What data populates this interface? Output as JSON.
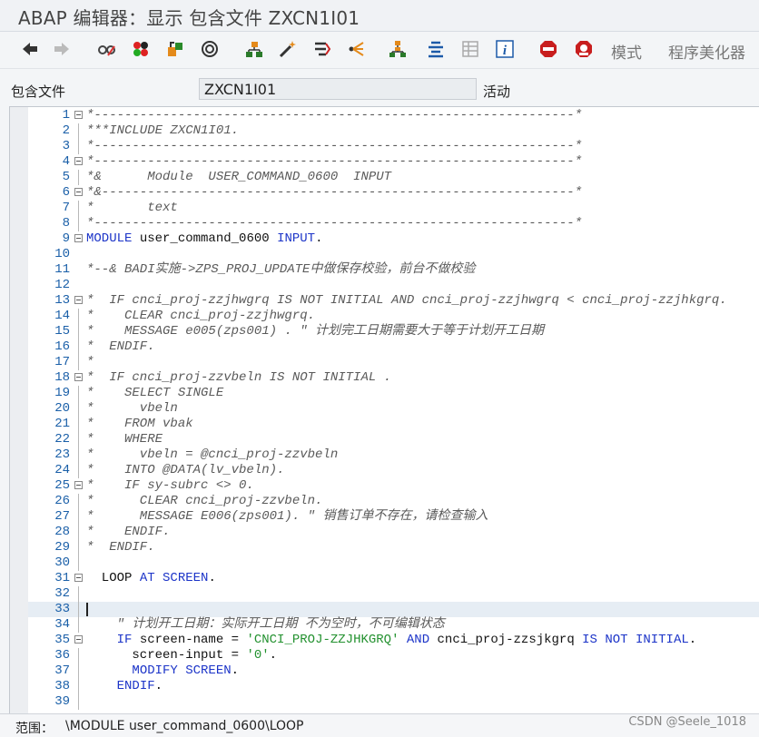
{
  "window": {
    "title": "ABAP 编辑器：显示 包含文件 ZXCN1I01"
  },
  "toolbar": {
    "icons": [
      "back-arrow-icon",
      "forward-arrow-icon",
      "glasses-display-change-icon",
      "activate-icon",
      "object-transfer-icon",
      "object-list-icon",
      "hierarchy-icon",
      "magic-wand-icon",
      "where-used-icon",
      "navigate-icon",
      "org-chart-icon",
      "pretty-list-icon",
      "table-grid-icon",
      "info-icon",
      "stop-breakpoint-icon",
      "session-breakpoint-icon"
    ],
    "mode_label": "模式",
    "pretty_printer_label": "程序美化器"
  },
  "header": {
    "include_label": "包含文件",
    "include_value": "ZXCN1I01",
    "status": "活动"
  },
  "editor": {
    "lines": [
      {
        "n": "1",
        "fold": "start",
        "segs": [
          {
            "t": "c",
            "v": "*---------------------------------------------------------------*"
          }
        ]
      },
      {
        "n": "2",
        "fold": "line",
        "segs": [
          {
            "t": "c",
            "v": "***INCLUDE ZXCN1I01."
          }
        ]
      },
      {
        "n": "3",
        "fold": "line",
        "segs": [
          {
            "t": "c",
            "v": "*---------------------------------------------------------------*"
          }
        ]
      },
      {
        "n": "4",
        "fold": "start",
        "segs": [
          {
            "t": "c",
            "v": "*---------------------------------------------------------------*"
          }
        ]
      },
      {
        "n": "5",
        "fold": "line",
        "segs": [
          {
            "t": "c",
            "v": "*&      Module  USER_COMMAND_0600  INPUT"
          }
        ]
      },
      {
        "n": "6",
        "fold": "start",
        "segs": [
          {
            "t": "c",
            "v": "*&--------------------------------------------------------------*"
          }
        ]
      },
      {
        "n": "7",
        "fold": "line",
        "segs": [
          {
            "t": "c",
            "v": "*       text"
          }
        ]
      },
      {
        "n": "8",
        "fold": "line",
        "segs": [
          {
            "t": "c",
            "v": "*---------------------------------------------------------------*"
          }
        ]
      },
      {
        "n": "9",
        "fold": "start",
        "segs": [
          {
            "t": "k",
            "v": "MODULE"
          },
          {
            "t": "n",
            "v": " user_command_0600 "
          },
          {
            "t": "k",
            "v": "INPUT"
          },
          {
            "t": "n",
            "v": "."
          }
        ]
      },
      {
        "n": "10",
        "fold": "none",
        "segs": []
      },
      {
        "n": "11",
        "fold": "none",
        "segs": [
          {
            "t": "c",
            "v": "*--& BADI实施->ZPS_PROJ_UPDATE中做保存校验，前台不做校验"
          }
        ]
      },
      {
        "n": "12",
        "fold": "none",
        "segs": []
      },
      {
        "n": "13",
        "fold": "start",
        "segs": [
          {
            "t": "c",
            "v": "*  IF cnci_proj-zzjhwgrq IS NOT INITIAL AND cnci_proj-zzjhwgrq < cnci_proj-zzjhkgrq."
          }
        ]
      },
      {
        "n": "14",
        "fold": "line",
        "segs": [
          {
            "t": "c",
            "v": "*    CLEAR cnci_proj-zzjhwgrq."
          }
        ]
      },
      {
        "n": "15",
        "fold": "line",
        "segs": [
          {
            "t": "c",
            "v": "*    MESSAGE e005(zps001) . \" 计划完工日期需要大于等于计划开工日期"
          }
        ]
      },
      {
        "n": "16",
        "fold": "line",
        "segs": [
          {
            "t": "c",
            "v": "*  ENDIF."
          }
        ]
      },
      {
        "n": "17",
        "fold": "line",
        "segs": [
          {
            "t": "c",
            "v": "*"
          }
        ]
      },
      {
        "n": "18",
        "fold": "start",
        "segs": [
          {
            "t": "c",
            "v": "*  IF cnci_proj-zzvbeln IS NOT INITIAL ."
          }
        ]
      },
      {
        "n": "19",
        "fold": "line",
        "segs": [
          {
            "t": "c",
            "v": "*    SELECT SINGLE"
          }
        ]
      },
      {
        "n": "20",
        "fold": "line",
        "segs": [
          {
            "t": "c",
            "v": "*      vbeln"
          }
        ]
      },
      {
        "n": "21",
        "fold": "line",
        "segs": [
          {
            "t": "c",
            "v": "*    FROM vbak"
          }
        ]
      },
      {
        "n": "22",
        "fold": "line",
        "segs": [
          {
            "t": "c",
            "v": "*    WHERE"
          }
        ]
      },
      {
        "n": "23",
        "fold": "line",
        "segs": [
          {
            "t": "c",
            "v": "*      vbeln = @cnci_proj-zzvbeln"
          }
        ]
      },
      {
        "n": "24",
        "fold": "line",
        "segs": [
          {
            "t": "c",
            "v": "*    INTO @DATA(lv_vbeln)."
          }
        ]
      },
      {
        "n": "25",
        "fold": "start",
        "segs": [
          {
            "t": "c",
            "v": "*    IF sy-subrc <> 0."
          }
        ]
      },
      {
        "n": "26",
        "fold": "line",
        "segs": [
          {
            "t": "c",
            "v": "*      CLEAR cnci_proj-zzvbeln."
          }
        ]
      },
      {
        "n": "27",
        "fold": "line",
        "segs": [
          {
            "t": "c",
            "v": "*      MESSAGE E006(zps001). \" 销售订单不存在，请检查输入"
          }
        ]
      },
      {
        "n": "28",
        "fold": "line",
        "segs": [
          {
            "t": "c",
            "v": "*    ENDIF."
          }
        ]
      },
      {
        "n": "29",
        "fold": "line",
        "segs": [
          {
            "t": "c",
            "v": "*  ENDIF."
          }
        ]
      },
      {
        "n": "30",
        "fold": "line",
        "segs": []
      },
      {
        "n": "31",
        "fold": "start",
        "segs": [
          {
            "t": "n",
            "v": "  LOOP "
          },
          {
            "t": "k",
            "v": "AT SCREEN"
          },
          {
            "t": "n",
            "v": "."
          }
        ]
      },
      {
        "n": "32",
        "fold": "line",
        "segs": []
      },
      {
        "n": "33",
        "fold": "line",
        "cur": true,
        "segs": []
      },
      {
        "n": "34",
        "fold": "line",
        "segs": [
          {
            "t": "c",
            "v": "    \" 计划开工日期：实际开工日期 不为空时，不可编辑状态"
          }
        ]
      },
      {
        "n": "35",
        "fold": "start",
        "segs": [
          {
            "t": "n",
            "v": "    "
          },
          {
            "t": "k",
            "v": "IF"
          },
          {
            "t": "n",
            "v": " screen-name = "
          },
          {
            "t": "s",
            "v": "'CNCI_PROJ-ZZJHKGRQ'"
          },
          {
            "t": "n",
            "v": " "
          },
          {
            "t": "k",
            "v": "AND"
          },
          {
            "t": "n",
            "v": " cnci_proj-zzsjkgrq "
          },
          {
            "t": "k",
            "v": "IS NOT INITIAL"
          },
          {
            "t": "n",
            "v": "."
          }
        ]
      },
      {
        "n": "36",
        "fold": "line",
        "segs": [
          {
            "t": "n",
            "v": "      screen-input = "
          },
          {
            "t": "s",
            "v": "'0'"
          },
          {
            "t": "n",
            "v": "."
          }
        ]
      },
      {
        "n": "37",
        "fold": "line",
        "segs": [
          {
            "t": "n",
            "v": "      "
          },
          {
            "t": "k",
            "v": "MODIFY SCREEN"
          },
          {
            "t": "n",
            "v": "."
          }
        ]
      },
      {
        "n": "38",
        "fold": "line",
        "segs": [
          {
            "t": "n",
            "v": "    "
          },
          {
            "t": "k",
            "v": "ENDIF"
          },
          {
            "t": "n",
            "v": "."
          }
        ]
      },
      {
        "n": "39",
        "fold": "line",
        "segs": []
      }
    ]
  },
  "statusbar": {
    "scope_label": "范围：",
    "scope_value": "\\MODULE user_command_0600\\LOOP"
  },
  "watermark": "CSDN @Seele_1018"
}
